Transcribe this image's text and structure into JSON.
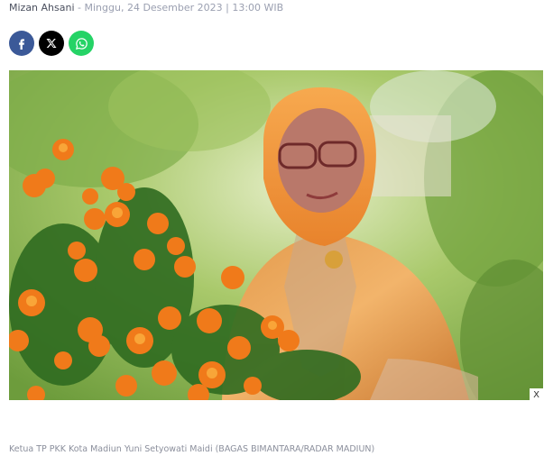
{
  "article": {
    "author": "Mizan Ahsani",
    "separator": " - ",
    "date": "Minggu, 24 Desember 2023 | 13:00 WIB"
  },
  "share": {
    "buttons": [
      {
        "icon": "facebook-icon",
        "color": "#3b5998"
      },
      {
        "icon": "x-icon",
        "color": "#000000"
      },
      {
        "icon": "whatsapp-icon",
        "color": "#25d366"
      }
    ]
  },
  "ad": {
    "close_label": "X"
  },
  "photo": {
    "caption": "Ketua TP PKK Kota Madiun Yuni Setyowati Maidi (BAGAS BIMANTARA/RADAR MADIUN)"
  }
}
